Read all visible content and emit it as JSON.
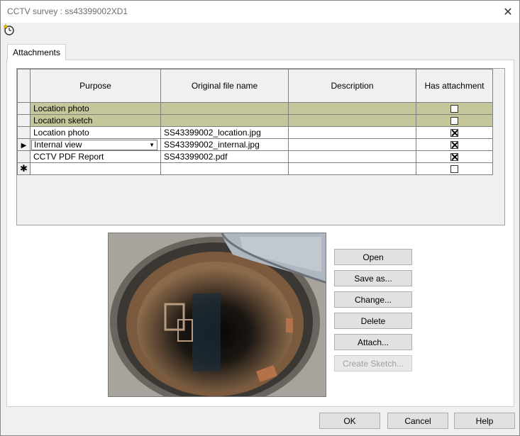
{
  "window": {
    "title": "CCTV survey : ss43399002XD1",
    "close_glyph": "✕"
  },
  "toolbar": {
    "icon": "clock-star-icon"
  },
  "tabs": [
    {
      "label": "Attachments"
    }
  ],
  "grid": {
    "columns": [
      "Purpose",
      "Original file name",
      "Description",
      "Has attachment"
    ],
    "rows": [
      {
        "purpose": "Location photo",
        "file": "",
        "description": "",
        "has_attachment": false,
        "highlight": true
      },
      {
        "purpose": "Location sketch",
        "file": "",
        "description": "",
        "has_attachment": false,
        "highlight": true
      },
      {
        "purpose": "Location photo",
        "file": "SS43399002_location.jpg",
        "description": "",
        "has_attachment": true,
        "highlight": false
      },
      {
        "purpose": "Internal view",
        "file": "SS43399002_internal.jpg",
        "description": "",
        "has_attachment": true,
        "highlight": false,
        "current": true,
        "editing": true
      },
      {
        "purpose": "CCTV PDF Report",
        "file": "SS43399002.pdf",
        "description": "",
        "has_attachment": true,
        "highlight": false
      }
    ],
    "row_indicator": "▶",
    "new_row_indicator": "✱",
    "highlight_color": "#c5c69a"
  },
  "preview": {
    "image": "manhole-interior-photo"
  },
  "actions": {
    "open": "Open",
    "save_as": "Save as...",
    "change": "Change...",
    "delete": "Delete",
    "attach": "Attach...",
    "create_sketch": "Create Sketch..."
  },
  "footer": {
    "ok": "OK",
    "cancel": "Cancel",
    "help": "Help"
  }
}
